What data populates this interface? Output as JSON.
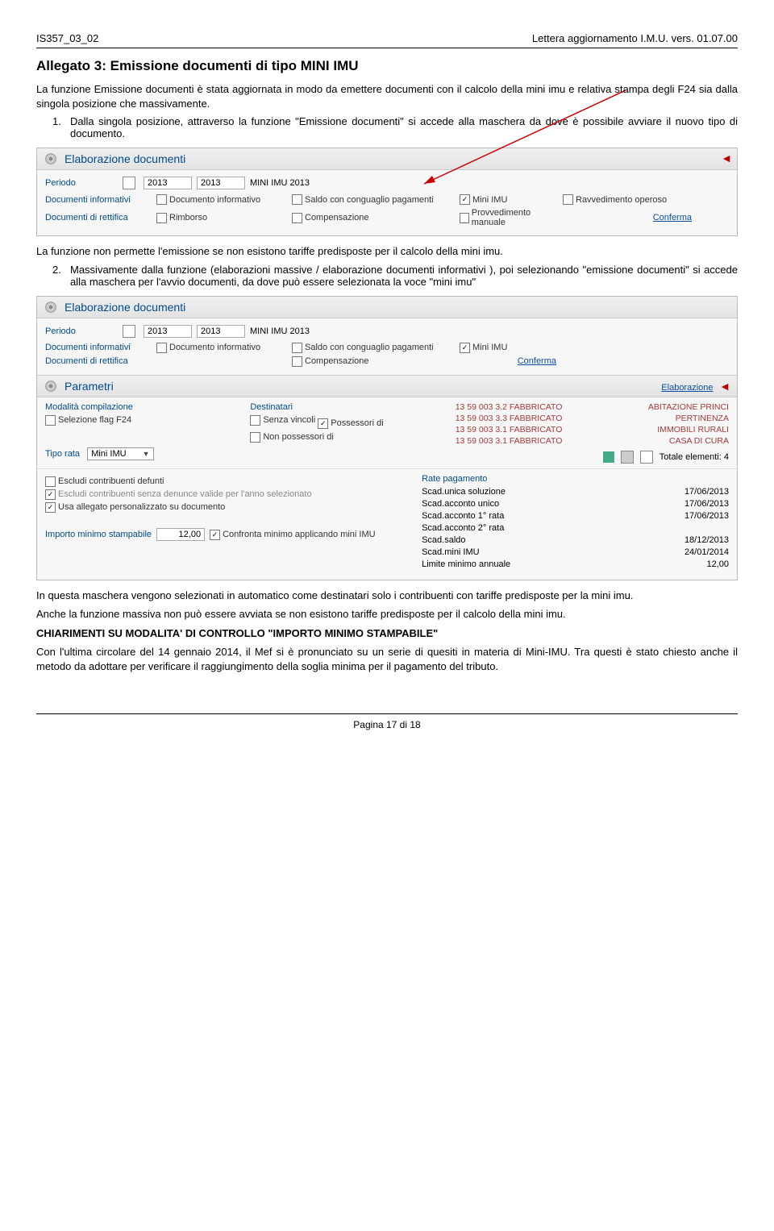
{
  "header": {
    "left": "IS357_03_02",
    "center": "Lettera aggiornamento  I.M.U.  vers.  01.07.00"
  },
  "title": "Allegato 3: Emissione documenti di tipo MINI IMU",
  "intro": "La funzione Emissione documenti è stata aggiornata in modo da emettere documenti con il calcolo della mini imu e relativa stampa degli F24 sia dalla singola posizione che massivamente.",
  "step1_num": "1.",
  "step1_text": "Dalla singola posizione, attraverso la funzione \"Emissione documenti\" si accede alla maschera da dove è possibile avviare il nuovo tipo di documento.",
  "ss1": {
    "title": "Elaborazione documenti",
    "periodo": "Periodo",
    "year1": "2013",
    "year2": "2013",
    "periodo_label": "MINI IMU 2013",
    "docinf": "Documenti informativi",
    "docrett": "Documenti di rettifica",
    "cb_docinf": "Documento informativo",
    "cb_saldo": "Saldo con conguaglio pagamenti",
    "cb_mini": "Mini IMU",
    "cb_ravv": "Ravvedimento operoso",
    "cb_rimb": "Rimborso",
    "cb_comp": "Compensazione",
    "cb_prov": "Provvedimento manuale",
    "conferma": "Conferma"
  },
  "para_after1": "La funzione non permette l'emissione se non esistono tariffe predisposte per il calcolo della mini imu.",
  "step2_num": "2.",
  "step2_text": "Massivamente dalla funzione (elaborazioni massive / elaborazione documenti informativi ), poi selezionando \"emissione documenti\" si accede alla maschera per l'avvio documenti, da dove può essere selezionata la voce \"mini imu\"",
  "ss2": {
    "title": "Elaborazione documenti",
    "periodo": "Periodo",
    "year1": "2013",
    "year2": "2013",
    "periodo_label": "MINI IMU 2013",
    "docinf": "Documenti informativi",
    "docrett": "Documenti di rettifica",
    "cb_docinf": "Documento informativo",
    "cb_saldo": "Saldo con conguaglio pagamenti",
    "cb_mini": "Mini IMU",
    "cb_comp": "Compensazione",
    "conferma": "Conferma",
    "param_title": "Parametri",
    "elaborazione": "Elaborazione",
    "modalita": "Modalità compilazione",
    "selflag": "Selezione flag F24",
    "tiporata_lbl": "Tipo rata",
    "tiporata_val": "Mini IMU",
    "dest_hdr": "Destinatari",
    "dest1": "Senza vincoli",
    "dest2": "Possessori di",
    "dest3": "Non possessori di",
    "fab": [
      {
        "l": "13 59 003  3.2 FABBRICATO",
        "r": "ABITAZIONE PRINCI"
      },
      {
        "l": "13 59 003  3.3 FABBRICATO",
        "r": "PERTINENZA"
      },
      {
        "l": "13 59 003  3.1 FABBRICATO",
        "r": "IMMOBILI RURALI"
      },
      {
        "l": "13 59 003  3.1 FABBRICATO",
        "r": "CASA DI CURA"
      }
    ],
    "tot_lbl": "Totale elementi: 4",
    "excl": "Escludi contribuenti defunti",
    "excl2": "Escludi contribuenti senza denunce valide per l'anno selezionato",
    "usaall": "Usa allegato personalizzato su documento",
    "importo_lbl": "Importo minimo stampabile",
    "importo_val": "12,00",
    "confronta": "Confronta minimo applicando mini IMU",
    "rate_hdr": "Rate pagamento",
    "rates": [
      {
        "l": "Scad.unica soluzione",
        "r": "17/06/2013"
      },
      {
        "l": "Scad.acconto unico",
        "r": "17/06/2013"
      },
      {
        "l": "Scad.acconto 1° rata",
        "r": "17/06/2013"
      },
      {
        "l": "Scad.acconto 2° rata",
        "r": ""
      },
      {
        "l": "Scad.saldo",
        "r": "18/12/2013"
      },
      {
        "l": "Scad.mini IMU",
        "r": "24/01/2014"
      },
      {
        "l": "Limite minimo annuale",
        "r": "12,00"
      }
    ]
  },
  "para3": "In questa maschera vengono selezionati in automatico come destinatari solo i contribuenti con tariffe predisposte per la mini imu.",
  "para4": "Anche la funzione massiva non può essere avviata se non esistono tariffe predisposte per il calcolo della mini imu.",
  "chiar_hdr": "CHIARIMENTI SU MODALITA' DI CONTROLLO \"IMPORTO MINIMO STAMPABILE\"",
  "para5": "Con l'ultima circolare del 14 gennaio 2014, il Mef si è pronunciato su un serie di quesiti in materia di Mini-IMU. Tra questi è stato chiesto anche il metodo da adottare per verificare il raggiungimento della soglia minima per il pagamento del tributo.",
  "footer": "Pagina 17 di 18"
}
